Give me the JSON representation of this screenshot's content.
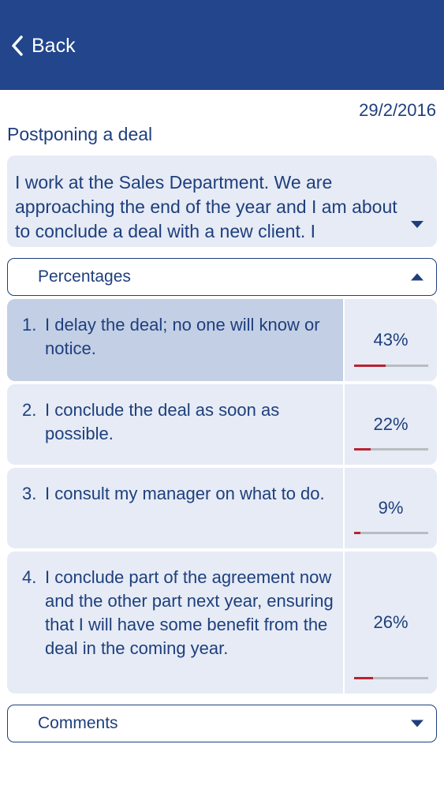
{
  "header": {
    "back_label": "Back",
    "bg_color": "#22458c"
  },
  "date": "29/2/2016",
  "title": "Postponing a deal",
  "description": "I work at the Sales Department. We are approaching the end of the year and I am about to conclude a deal with a new client. I",
  "percentages_label": "Percentages",
  "options": [
    {
      "number": "1.",
      "text": "I delay the deal; no one will know or notice.",
      "percent_label": "43%",
      "percent": 43,
      "selected": true
    },
    {
      "number": "2.",
      "text": "I conclude the deal as soon as possible.",
      "percent_label": "22%",
      "percent": 22,
      "selected": false
    },
    {
      "number": "3.",
      "text": "I consult my manager on what to do.",
      "percent_label": "9%",
      "percent": 9,
      "selected": false
    },
    {
      "number": "4.",
      "text": "I conclude part of the agreement now and the other part next year, ensuring that I will have some benefit from the deal in the coming year.",
      "percent_label": "26%",
      "percent": 26,
      "selected": false
    }
  ],
  "comments_label": "Comments",
  "colors": {
    "accent": "#1e3f7d",
    "panel": "#e6ebf5",
    "selected": "#c3cfe5",
    "bar_fill": "#b8232f",
    "bar_track": "#b9bcc1"
  }
}
